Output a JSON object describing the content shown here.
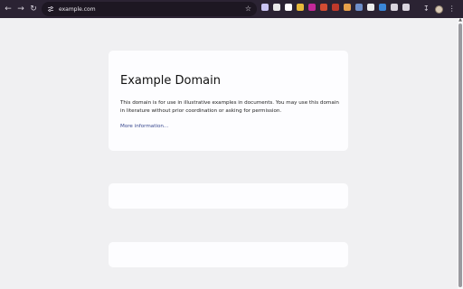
{
  "browser": {
    "url": "example.com",
    "icons": {
      "back": "back-arrow-icon",
      "forward": "forward-arrow-icon",
      "reload": "reload-icon",
      "site_info": "tune-icon",
      "bookmark": "star-icon"
    },
    "extensions": [
      {
        "name": "ext-icon-1",
        "color": "#c9c3f2"
      },
      {
        "name": "ext-icon-2",
        "color": "#e8e8e8"
      },
      {
        "name": "ext-icon-3",
        "color": "#ffffff"
      },
      {
        "name": "ext-icon-4",
        "color": "#e7b93a"
      },
      {
        "name": "ext-icon-5",
        "color": "#c4289a"
      },
      {
        "name": "ext-icon-6",
        "color": "#d24c33"
      },
      {
        "name": "ext-icon-7",
        "color": "#c0392b"
      },
      {
        "name": "ext-icon-8",
        "color": "#e6a04a"
      },
      {
        "name": "ext-icon-9",
        "color": "#6e8ec9"
      },
      {
        "name": "ext-icon-10",
        "color": "#ededed"
      },
      {
        "name": "ext-icon-11",
        "color": "#3a86d8"
      },
      {
        "name": "ext-icon-12",
        "color": "#d9d4de"
      },
      {
        "name": "ext-icon-13",
        "color": "#d9d4de"
      }
    ]
  },
  "page": {
    "heading": "Example Domain",
    "body": "This domain is for use in illustrative examples in documents. You may use this domain in literature without prior coordination or asking for permission.",
    "link_text": "More information..."
  },
  "colors": {
    "page_background": "#f0f0f2",
    "card_background": "#fdfdff",
    "link": "#38488f",
    "toolbar": "#2b2333"
  }
}
